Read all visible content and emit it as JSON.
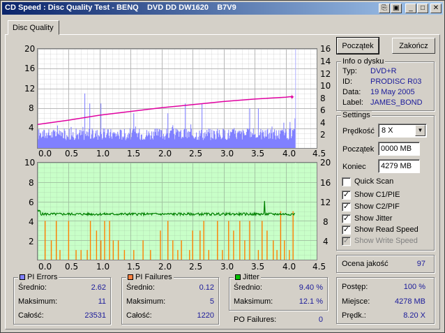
{
  "window": {
    "title": "CD Speed : Disc Quality Test - BENQ    DVD DD DW1620    B7V9",
    "colors": {
      "title_start": "#0a246a",
      "title_end": "#a6caf0"
    }
  },
  "tab": {
    "label": "Disc Quality"
  },
  "buttons": {
    "start": "Początek",
    "stop": "Zakończ"
  },
  "info": {
    "title": "Info o dysku",
    "rows": [
      {
        "label": "Typ:",
        "value": "DVD+R"
      },
      {
        "label": "ID:",
        "value": "PRODISC R03"
      },
      {
        "label": "Data:",
        "value": "19 May 2005"
      },
      {
        "label": "Label:",
        "value": "JAMES_BOND"
      }
    ]
  },
  "settings": {
    "title": "Settings",
    "speed_label": "Prędkość",
    "speed_value": "8 X",
    "start_label": "Początek",
    "start_value": "0000 MB",
    "end_label": "Koniec",
    "end_value": "4279 MB",
    "checks": [
      {
        "label": "Quick Scan",
        "checked": false,
        "disabled": false
      },
      {
        "label": "Show C1/PIE",
        "checked": true,
        "disabled": false
      },
      {
        "label": "Show C2/PIF",
        "checked": true,
        "disabled": false
      },
      {
        "label": "Show Jitter",
        "checked": true,
        "disabled": false
      },
      {
        "label": "Show Read Speed",
        "checked": true,
        "disabled": false
      },
      {
        "label": "Show Write Speed",
        "checked": true,
        "disabled": true
      }
    ]
  },
  "quality": {
    "label": "Ocena jakość",
    "value": "97"
  },
  "progress": {
    "rows": [
      {
        "label": "Postęp:",
        "value": "100 %"
      },
      {
        "label": "Miejsce:",
        "value": "4278 MB"
      },
      {
        "label": "Prędk.:",
        "value": "8.20 X"
      }
    ]
  },
  "stats": {
    "pi_errors": {
      "title": "PI Errors",
      "color": "#8080ff",
      "rows": [
        {
          "label": "Średnio:",
          "value": "2.62"
        },
        {
          "label": "Maksimum:",
          "value": "11"
        },
        {
          "label": "Całość:",
          "value": "23531"
        }
      ]
    },
    "pi_failures": {
      "title": "PI Failures",
      "color": "#ff8040",
      "rows": [
        {
          "label": "Średnio:",
          "value": "0.12"
        },
        {
          "label": "Maksimum:",
          "value": "5"
        },
        {
          "label": "Całość:",
          "value": "1220"
        }
      ]
    },
    "jitter": {
      "title": "Jitter",
      "color": "#00c000",
      "rows": [
        {
          "label": "Średnio:",
          "value": "9.40 %"
        },
        {
          "label": "Maksimum:",
          "value": "12.1 %"
        }
      ]
    },
    "po_failures": {
      "label": "PO Failures:",
      "value": "0"
    }
  },
  "chart_data": [
    {
      "type": "bar",
      "name": "PI Errors / Read Speed",
      "x_range": [
        0,
        4.5
      ],
      "x_ticks": [
        "0.0",
        "0.5",
        "1.0",
        "1.5",
        "2.0",
        "2.5",
        "3.0",
        "3.5",
        "4.0",
        "4.5"
      ],
      "y_left_range": [
        0,
        20
      ],
      "y_left_ticks": [
        "20",
        "16",
        "12",
        "8",
        "4"
      ],
      "y_right_range": [
        0,
        16
      ],
      "y_right_ticks": [
        "16",
        "14",
        "12",
        "10",
        "8",
        "6",
        "4",
        "2"
      ],
      "pi_errors_avg": 2.62,
      "pi_errors_max": 11,
      "pi_errors_spikes": [
        [
          0.76,
          11
        ],
        [
          0.84,
          9
        ],
        [
          1.02,
          9
        ],
        [
          2.38,
          9
        ],
        [
          2.65,
          9
        ],
        [
          3.42,
          8
        ],
        [
          3.56,
          8
        ],
        [
          1.55,
          7
        ],
        [
          2.1,
          7
        ]
      ],
      "read_speed_series": {
        "x": [
          0.0,
          0.5,
          1.0,
          1.5,
          2.0,
          2.5,
          3.0,
          3.5,
          4.0,
          4.1
        ],
        "y": [
          3.8,
          4.5,
          5.3,
          5.9,
          6.5,
          7.0,
          7.5,
          7.9,
          8.2,
          8.3
        ]
      },
      "colors": {
        "bars": "#8080ff",
        "speed": "#e000a0",
        "background": "#ffffff",
        "grid": "#b0b0b0"
      }
    },
    {
      "type": "bar",
      "name": "PI Failures / Jitter",
      "x_range": [
        0,
        4.5
      ],
      "x_ticks": [
        "0.0",
        "0.5",
        "1.0",
        "1.5",
        "2.0",
        "2.5",
        "3.0",
        "3.5",
        "4.0",
        "4.5"
      ],
      "y_left_range": [
        0,
        10
      ],
      "y_left_ticks": [
        "10",
        "8",
        "6",
        "4",
        "2"
      ],
      "y_right_range": [
        0,
        20
      ],
      "y_right_ticks": [
        "20",
        "16",
        "12",
        "8",
        "4"
      ],
      "pi_failures_bars": [
        [
          0.12,
          4
        ],
        [
          0.22,
          2
        ],
        [
          0.3,
          4
        ],
        [
          0.36,
          1
        ],
        [
          0.5,
          4
        ],
        [
          0.62,
          1
        ],
        [
          0.7,
          1
        ],
        [
          0.8,
          1
        ],
        [
          0.85,
          4
        ],
        [
          0.95,
          3
        ],
        [
          1.02,
          2
        ],
        [
          1.08,
          4
        ],
        [
          1.16,
          4
        ],
        [
          1.22,
          2
        ],
        [
          1.3,
          2
        ],
        [
          1.4,
          1
        ],
        [
          1.55,
          1
        ],
        [
          1.7,
          2
        ],
        [
          1.82,
          1
        ],
        [
          1.98,
          3
        ],
        [
          2.1,
          4
        ],
        [
          2.18,
          2
        ],
        [
          2.26,
          1
        ],
        [
          2.32,
          2
        ],
        [
          2.45,
          1
        ],
        [
          2.5,
          3
        ],
        [
          2.62,
          3
        ],
        [
          2.68,
          4
        ],
        [
          2.76,
          1
        ],
        [
          2.9,
          4
        ],
        [
          2.98,
          1
        ],
        [
          3.08,
          4
        ],
        [
          3.16,
          3
        ],
        [
          3.26,
          4
        ],
        [
          3.34,
          2
        ],
        [
          3.42,
          4
        ],
        [
          3.56,
          1
        ],
        [
          3.62,
          4
        ],
        [
          3.7,
          3
        ],
        [
          3.8,
          2
        ],
        [
          3.86,
          1
        ],
        [
          3.92,
          5
        ],
        [
          3.98,
          2
        ],
        [
          4.06,
          1
        ],
        [
          4.12,
          5
        ]
      ],
      "jitter_avg": 9.4,
      "jitter_max": 12.1,
      "colors": {
        "bars": "#ff8000",
        "jitter": "#008000",
        "background": "#c8ffc8",
        "grid": "#a0c0a0"
      }
    }
  ]
}
